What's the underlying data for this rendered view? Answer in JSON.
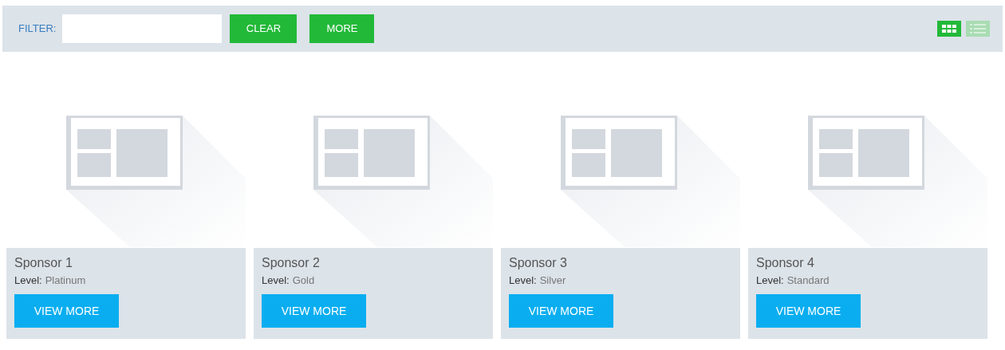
{
  "toolbar": {
    "filter_label": "FILTER:",
    "buttons": [
      "CLEAR",
      "MORE"
    ],
    "view_modes": [
      {
        "kind": "grid",
        "selected": true
      },
      {
        "kind": "list",
        "selected": false
      }
    ]
  },
  "cards": [
    {
      "name": "Sponsor 1",
      "level_label": "Level:",
      "level": "Platinum",
      "button": "VIEW MORE"
    },
    {
      "name": "Sponsor 2",
      "level_label": "Level:",
      "level": "Gold",
      "button": "VIEW MORE"
    },
    {
      "name": "Sponsor 3",
      "level_label": "Level:",
      "level": "Silver",
      "button": "VIEW MORE"
    },
    {
      "name": "Sponsor 4",
      "level_label": "Level:",
      "level": "Standard",
      "button": "VIEW MORE"
    }
  ]
}
